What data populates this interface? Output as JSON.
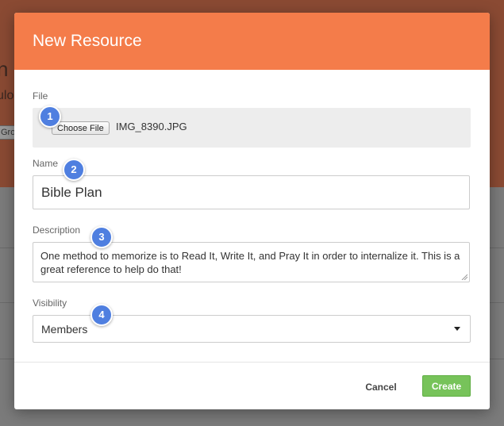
{
  "background": {
    "heading_fragment": "n",
    "subheading_fragment": "ulo",
    "chip_fragment": "Gro"
  },
  "modal": {
    "title": "New Resource",
    "file": {
      "label": "File",
      "button_label": "Choose File",
      "file_name": "IMG_8390.JPG"
    },
    "name": {
      "label": "Name",
      "value": "Bible Plan"
    },
    "description": {
      "label": "Description",
      "value": "One method to memorize is to Read It, Write It, and Pray It in order to internalize it. This is a great reference to help do that!"
    },
    "visibility": {
      "label": "Visibility",
      "selected": "Members"
    },
    "footer": {
      "cancel_label": "Cancel",
      "create_label": "Create"
    }
  },
  "annotations": {
    "badge_1": "1",
    "badge_2": "2",
    "badge_3": "3",
    "badge_4": "4"
  },
  "colors": {
    "header": "#f47c4a",
    "create_button": "#77c35a",
    "badge": "#4f7fe0"
  }
}
